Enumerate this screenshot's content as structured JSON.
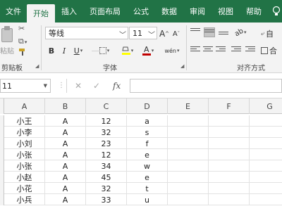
{
  "ribbon_tabs": {
    "file": "文件",
    "items": [
      "开始",
      "插入",
      "页面布局",
      "公式",
      "数据",
      "审阅",
      "视图",
      "帮助"
    ],
    "active_index": 0,
    "help_icon": "lightbulb-icon"
  },
  "clipboard": {
    "paste_label": "粘贴",
    "group_label": "剪贴板"
  },
  "font_group": {
    "font_name": "等线",
    "font_size": "11",
    "grow": "A",
    "shrink": "A",
    "bold": "B",
    "italic": "I",
    "underline": "U",
    "phonetic": "wén",
    "group_label": "字体",
    "font_color": "#c00000",
    "highlight_color": "#ffff00"
  },
  "alignment_group": {
    "group_label": "对齐方式",
    "wrap_char": "自",
    "merge_char": "合"
  },
  "formula_bar": {
    "namebox_value": "11",
    "cancel": "✕",
    "enter": "✓",
    "fx": "fx",
    "content": ""
  },
  "sheet": {
    "columns": [
      "A",
      "B",
      "C",
      "D",
      "E",
      "F",
      "G"
    ],
    "rows": [
      [
        "小王",
        "A",
        "12",
        "a"
      ],
      [
        "小李",
        "A",
        "32",
        "s"
      ],
      [
        "小刘",
        "A",
        "23",
        "f"
      ],
      [
        "小张",
        "A",
        "12",
        "e"
      ],
      [
        "小张",
        "A",
        "34",
        "w"
      ],
      [
        "小赵",
        "A",
        "45",
        "e"
      ],
      [
        "小花",
        "A",
        "32",
        "t"
      ],
      [
        "小兵",
        "A",
        "33",
        "u"
      ]
    ]
  },
  "colors": {
    "brand": "#217346",
    "ribbon_bg": "#f3f3f3"
  }
}
